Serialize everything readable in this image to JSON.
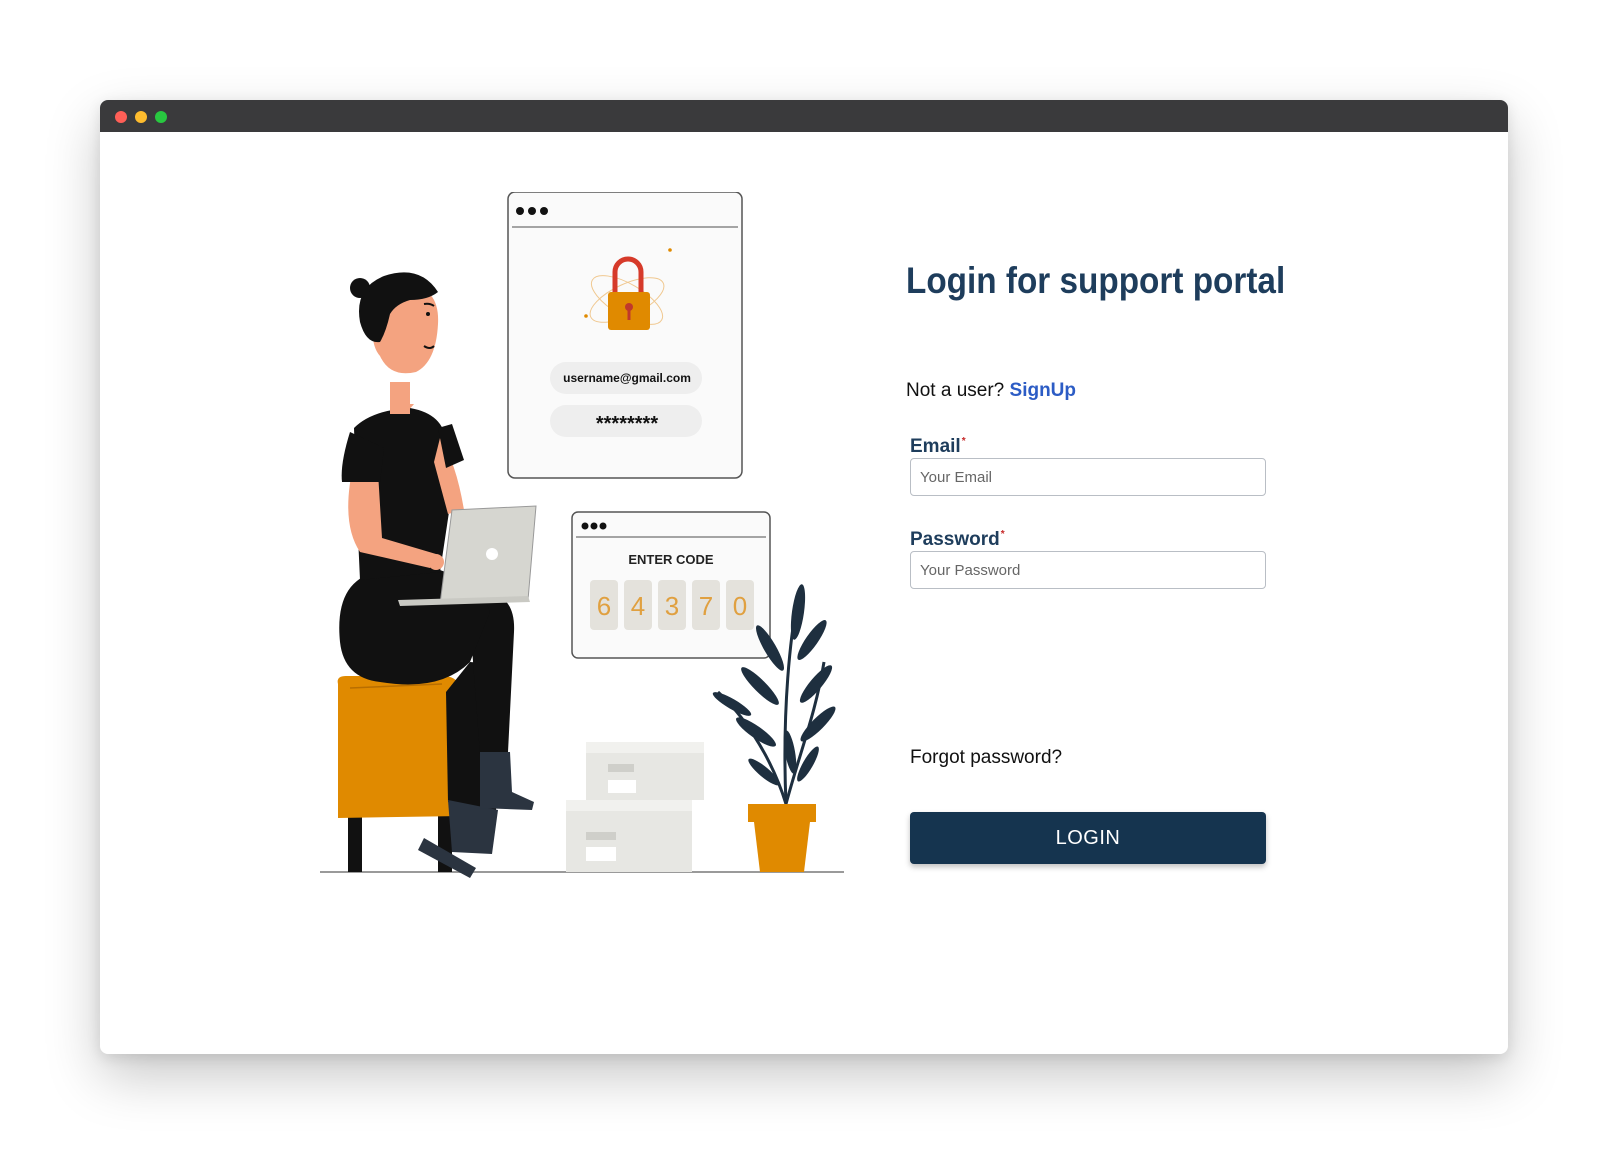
{
  "colors": {
    "title": "#1e3d5c",
    "label": "#1e3d5c",
    "link": "#2c5cc5",
    "required": "#c62828",
    "button_bg": "#15344f",
    "accent_orange": "#e08a00"
  },
  "illustration": {
    "email_text": "username@gmail.com",
    "password_text": "********",
    "code_title": "ENTER CODE",
    "code_digits": [
      "6",
      "4",
      "3",
      "7",
      "0"
    ]
  },
  "form": {
    "title": "Login for support portal",
    "signup_prompt": "Not a user?",
    "signup_link": "SignUp",
    "email_label": "Email",
    "email_placeholder": "Your Email",
    "password_label": "Password",
    "password_placeholder": "Your Password",
    "required_marker": "*",
    "forgot_password": "Forgot password?",
    "login_button": "LOGIN"
  }
}
